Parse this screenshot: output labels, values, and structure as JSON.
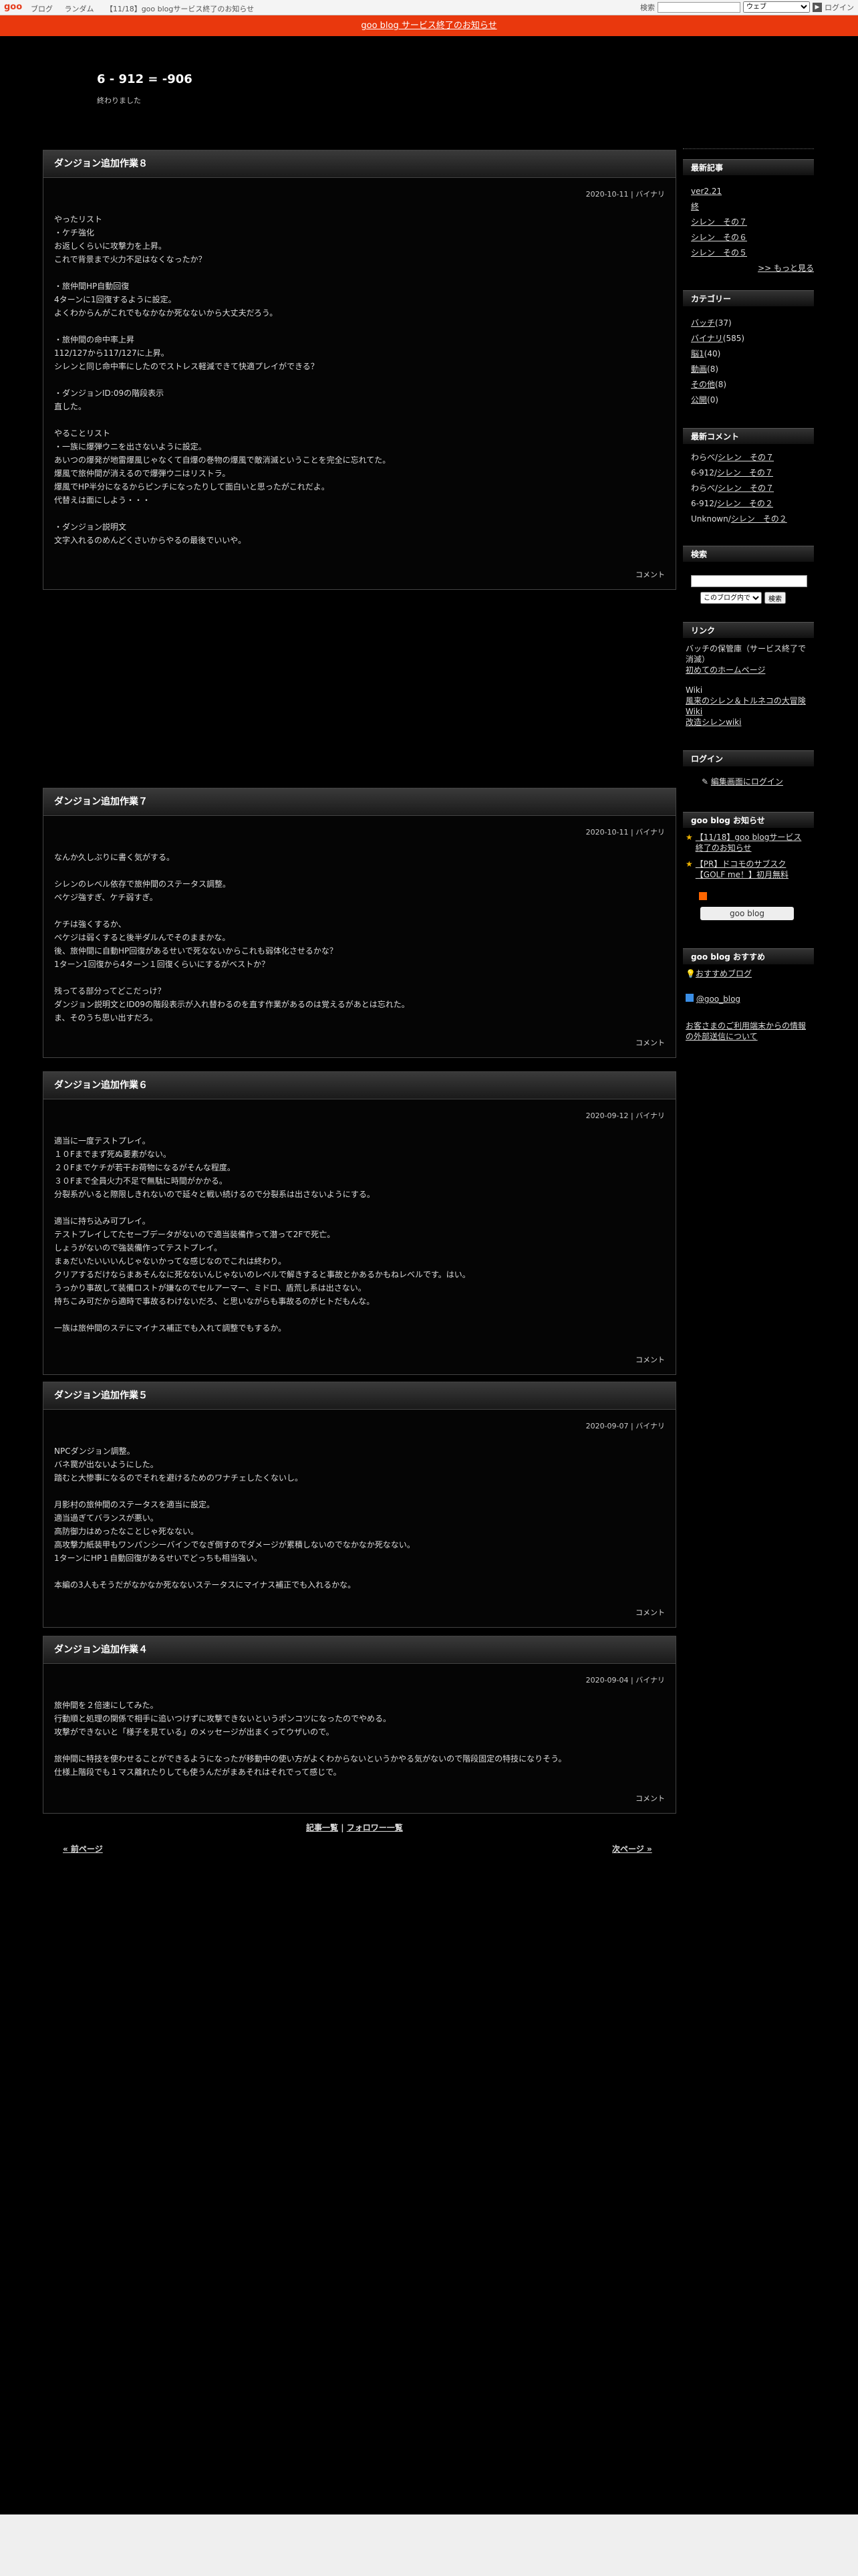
{
  "topbar": {
    "logo": "goo",
    "nav": [
      "ブログ",
      "ランダム",
      "【11/18】goo blogサービス終了のお知らせ"
    ],
    "search_label": "検索",
    "search_placeholder": "",
    "search_scope": "ウェブ",
    "login": "ログイン"
  },
  "notice": "goo blog サービス終了のお知らせ",
  "site": {
    "title": "6 - 912 = -906",
    "desc": "終わりました"
  },
  "posts": [
    {
      "title": "ダンジョン追加作業８",
      "meta": "2020-10-11 | バイナリ",
      "body": "やったリスト\n・ケチ強化\nお返しくらいに攻撃力を上昇。\nこれで背景まで火力不足はなくなったか？\n\n・旅仲間HP自動回復\n4ターンに1回復するように設定。\nよくわからんがこれでもなかなか死なないから大丈夫だろう。\n\n・旅仲間の命中率上昇\n112/127から117/127に上昇。\nシレンと同じ命中率にしたのでストレス軽減できて快適プレイができる？\n\n・ダンジョンID:09の階段表示\n直した。\n\nやることリスト\n・一族に爆弾ウニを出さないように設定。\nあいつの爆発が地雷爆風じゃなくて自爆の巻物の爆風で敵消滅ということを完全に忘れてた。\n爆風で旅仲間が消えるので爆弾ウニはリストラ。\n爆風でHP半分になるからピンチになったりして面白いと思ったがこれだよ。\n代替えは面にしよう・・・\n\n・ダンジョン説明文\n文字入れるのめんどくさいからやるの最後でいいや。",
      "comment": "コメント"
    },
    {
      "title": "ダンジョン追加作業７",
      "meta": "2020-10-11 | バイナリ",
      "body": "なんか久しぶりに書く気がする。\n\nシレンのレベル依存で旅仲間のステータス調整。\nペケジ強すぎ、ケチ弱すぎ。\n\nケチは強くするか、\nペケジは弱くすると後半ダルんでそのままかな。\n後、旅仲間に自動HP回復があるせいで死なないからこれも弱体化させるかな？\n1ターン1回復から4ターン１回復くらいにするがベストか？\n\n残ってる部分ってどこだっけ？\nダンジョン説明文とID09の階段表示が入れ替わるのを直す作業があるのは覚えるがあとは忘れた。\nま、そのうち思い出すだろ。",
      "comment": "コメント"
    },
    {
      "title": "ダンジョン追加作業６",
      "meta": "2020-09-12 | バイナリ",
      "body": "適当に一度テストプレイ。\n１０Fまでまず死ぬ要素がない。\n２０Fまでケチが若干お荷物になるがそんな程度。\n３０Fまで全員火力不足で無駄に時間がかかる。\n分裂系がいると際限しきれないので延々と戦い続けるので分裂系は出さないようにする。\n\n適当に持ち込み可プレイ。\nテストプレイしてたセーブデータがないので適当装備作って潜って2Fで死亡。\nしょうがないので強装備作ってテストプレイ。\nまぁだいたいいいんじゃないかってな感じなのでこれは終わり。\nクリアするだけならまあそんなに死なないんじゃないのレベルで解きすると事故とかあるかもねレベルです。はい。\nうっかり事故して装備ロストが嫌なのでセルアーマー、ミドロ、盾荒し系は出さない。\n持ちこみ可だから適時で事故るわけないだろ、と思いながらも事故るのがヒトだもんな。\n\n一族は旅仲間のステにマイナス補正でも入れて調整でもするか。",
      "comment": "コメント"
    },
    {
      "title": "ダンジョン追加作業５",
      "meta": "2020-09-07 | バイナリ",
      "body": "NPCダンジョン調整。\nバネ罠が出ないようにした。\n踏むと大惨事になるのでそれを避けるためのワナチェしたくないし。\n\n月影村の旅仲間のステータスを適当に設定。\n適当過ぎてバランスが悪い。\n高防御力はめったなことじゃ死なない。\n高攻撃力紙装甲もワンパンシーバインでなぎ倒すのでダメージが累積しないのでなかなか死なない。\n1ターンにHP１自動回復があるせいでどっちも相当強い。\n\n本編の3人もそうだがなかなか死なないステータスにマイナス補正でも入れるかな。",
      "comment": "コメント"
    },
    {
      "title": "ダンジョン追加作業４",
      "meta": "2020-09-04 | バイナリ",
      "body": "旅仲間を２倍速にしてみた。\n行動順と処理の関係で相手に追いつけずに攻撃できないというポンコツになったのでやめる。\n攻撃ができないと「様子を見ている」のメッセージが出まくってウザいので。\n\n旅仲間に特技を使わせることができるようになったが移動中の使い方がよくわからないというかやる気がないので階段固定の特技になりそう。\n仕様上階段でも１マス離れたりしても使うんだがまあそれはそれでって感じで。",
      "comment": "コメント"
    }
  ],
  "pager": {
    "list": "記事一覧",
    "followers": "フォロワー一覧",
    "prev": "« 前ページ",
    "next": "次ページ »"
  },
  "sidebar": {
    "recent": {
      "title": "最新記事",
      "items": [
        "ver2.21",
        "終",
        "シレン　その７",
        "シレン　その６",
        "シレン　その５"
      ],
      "more": ">> もっと見る"
    },
    "category": {
      "title": "カテゴリー",
      "items": [
        {
          "name": "バッチ",
          "count": "(37)"
        },
        {
          "name": "バイナリ",
          "count": "(585)"
        },
        {
          "name": "脳1",
          "count": "(40)"
        },
        {
          "name": "動画",
          "count": "(8)"
        },
        {
          "name": "その他",
          "count": "(8)"
        },
        {
          "name": "公開",
          "count": "(0)"
        }
      ]
    },
    "comments": {
      "title": "最新コメント",
      "items": [
        {
          "who": "わらべ/",
          "post": "シレン　その７"
        },
        {
          "who": "6-912/",
          "post": "シレン　その７"
        },
        {
          "who": "わらべ/",
          "post": "シレン　その７"
        },
        {
          "who": "6-912/",
          "post": "シレン　その２"
        },
        {
          "who": "Unknown/",
          "post": "シレン　その２"
        }
      ]
    },
    "search": {
      "title": "検索",
      "scope": "このブログ内で",
      "button": "検索"
    },
    "links": {
      "title": "リンク",
      "text1": "バッチの保管庫（サービス終了で消滅）",
      "link1": "初めてのホームページ",
      "text2": "Wiki",
      "link2": "風来のシレン＆トルネコの大冒険 Wiki",
      "link3": "改造シレンwiki"
    },
    "login": {
      "title": "ログイン",
      "link": "編集画面にログイン"
    },
    "news": {
      "title": "goo blog お知らせ",
      "items": [
        "【11/18】goo blogサービス終了のお知らせ",
        "【PR】ドコモのサブスク【GOLF me！】初月無料"
      ],
      "badge": "goo blog"
    },
    "recommend": {
      "title": "goo blog おすすめ",
      "item1": "おすすめブログ",
      "item2": "@goo_blog",
      "item3": "お客さまのご利用端末からの情報の外部送信について"
    }
  },
  "colors": {
    "notice": "#e9380d",
    "bg": "#000000"
  }
}
